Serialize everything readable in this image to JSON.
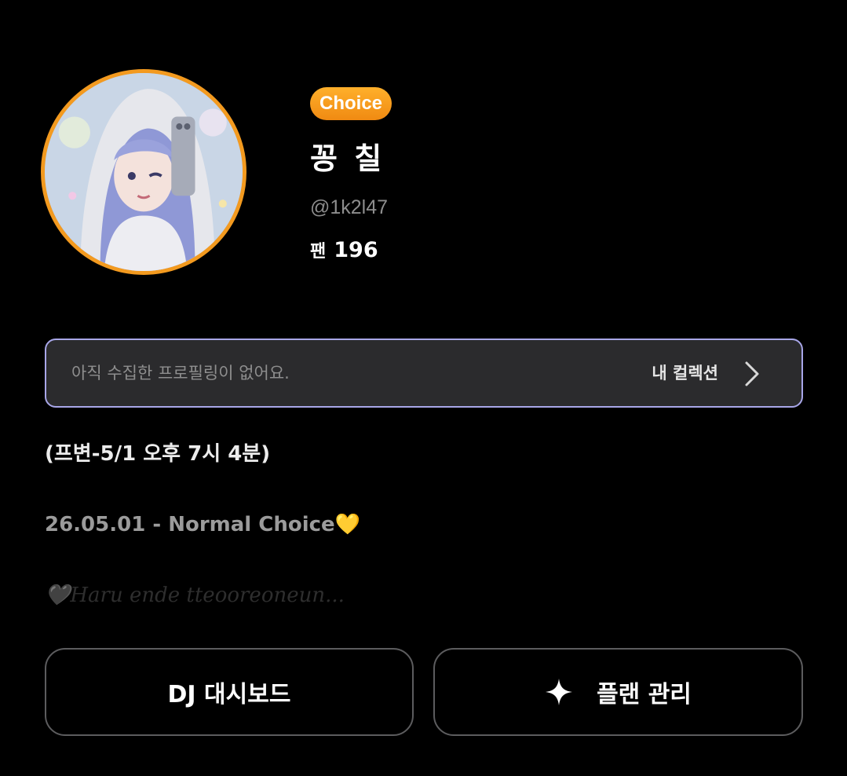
{
  "profile": {
    "badge": "Choice",
    "name": "꽁 칠",
    "handle": "@1k2l47",
    "fans_label": "팬",
    "fans_count": "196",
    "avatar_icon": "avatar-illustration"
  },
  "collection": {
    "empty_text": "아직 수집한 프로필링이 없어요.",
    "link_label": "내 컬렉션",
    "icon": "chevron-right-icon"
  },
  "bio": {
    "line1": "(프변-5/1 오후 7시 4분)",
    "line2": "26.05.01 - Normal Choice💛",
    "line3": "🖤Haru ende tteooreoneun..."
  },
  "actions": {
    "dashboard_label": "DJ 대시보드",
    "plan_label": "플랜 관리",
    "plan_icon": "sparkle-icon"
  },
  "colors": {
    "accent": "#f39a1f",
    "collection_border": "#a8a6e8",
    "background": "#000000"
  }
}
